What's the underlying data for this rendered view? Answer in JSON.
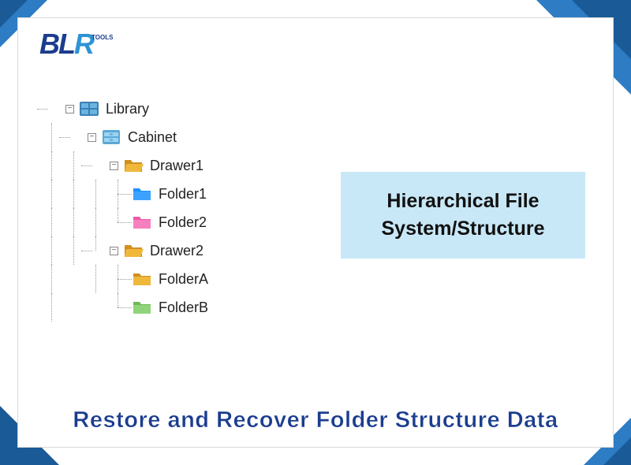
{
  "logo": {
    "text_main": "BL",
    "text_accent": "R",
    "text_tools": "TOOLS"
  },
  "tree": {
    "library": "Library",
    "cabinet": "Cabinet",
    "drawer1": "Drawer1",
    "folder1": "Folder1",
    "folder2": "Folder2",
    "drawer2": "Drawer2",
    "folderA": "FolderA",
    "folderB": "FolderB"
  },
  "callout": {
    "line1": "Hierarchical File",
    "line2": "System/Structure"
  },
  "banner": "Restore and Recover Folder Structure Data",
  "colors": {
    "library_icon": "#3a7fb5",
    "cabinet_icon": "#5ba8d6",
    "drawer_icon": "#f0b83a",
    "folder1_icon": "#1e90ff",
    "folder2_icon": "#f05aa8",
    "folderA_icon": "#f0b83a",
    "folderB_icon": "#8fd47a"
  }
}
